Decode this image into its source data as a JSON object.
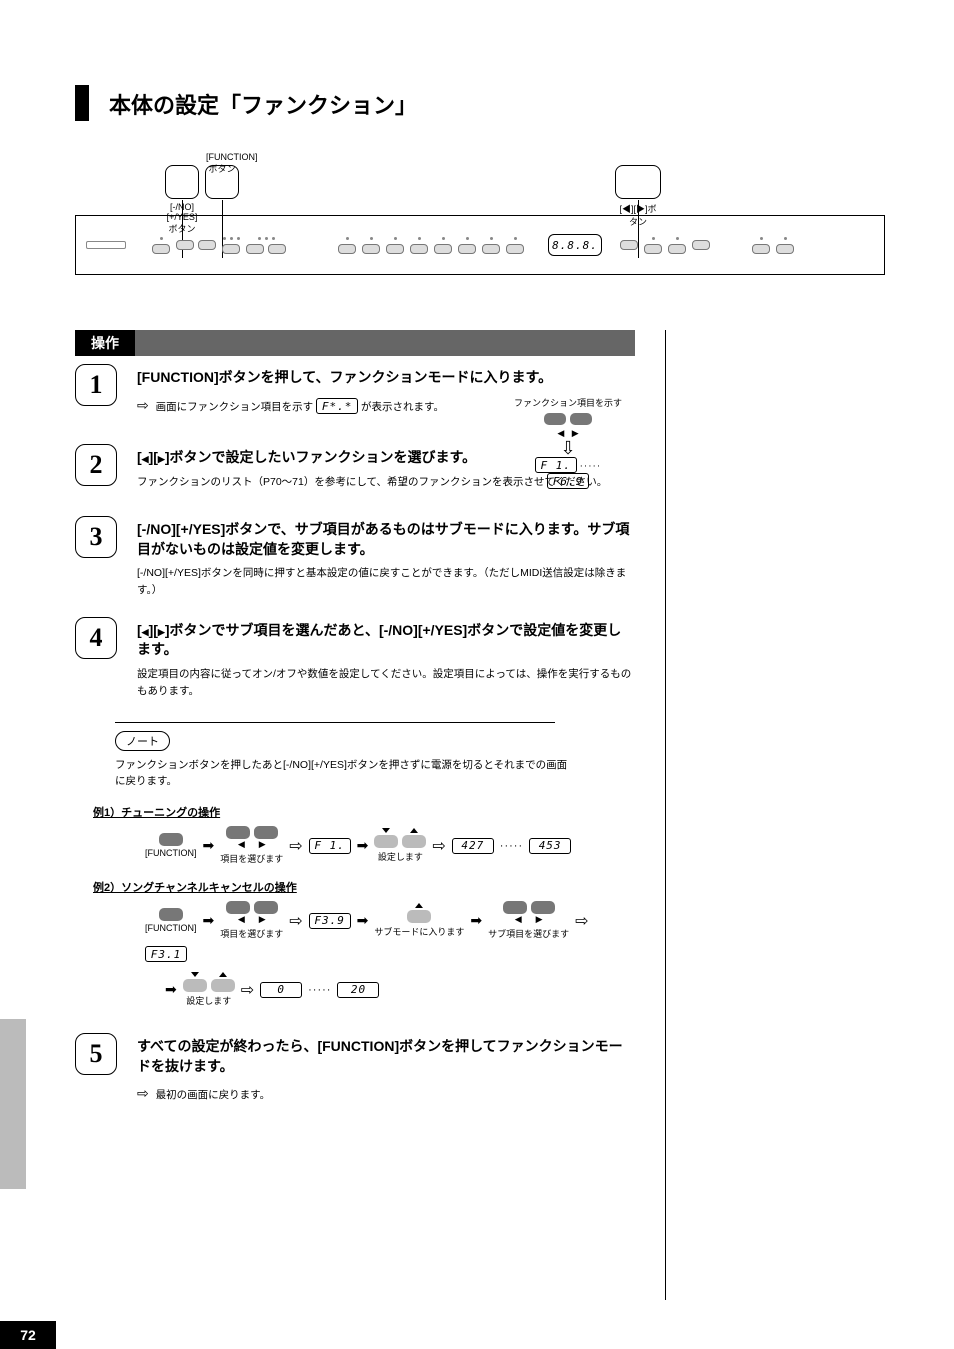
{
  "chapter": {
    "title": "本体の設定「ファンクション」"
  },
  "panel": {
    "callouts": {
      "left_prev": "[-/NO][+/YES]ボタン",
      "left_next": "[FUNCTION]ボタン",
      "right": "[◀][▶]ボタン"
    },
    "lcd": "8.8.8."
  },
  "operation": {
    "ribbon": "操作"
  },
  "steps": [
    {
      "num": "1",
      "title": "[FUNCTION]ボタンを押して、ファンクションモードに入ります。",
      "body_prefix": "",
      "body_arrow": "画面にファンクション項目を示す",
      "body_suffix": "が表示されます。"
    },
    {
      "num": "2",
      "title": "[◀][▶]ボタンで設定したいファンクションを選びます。",
      "body": "ファンクションのリスト（P70〜71）を参考にして、希望のファンクションを表示させてください。"
    },
    {
      "num": "3",
      "title": "[-/NO][+/YES]ボタンで、サブ項目があるものはサブモードに入ります。サブ項目がないものは設定値を変更します。",
      "body": "[-/NO][+/YES]ボタンを同時に押すと基本設定の値に戻すことができます。（ただしMIDI送信設定は除きます。）"
    },
    {
      "num": "4",
      "title": "[◀][▶]ボタンでサブ項目を選んだあと、[-/NO][+/YES]ボタンで設定値を変更します。",
      "body": "設定項目の内容に従ってオン/オフや数値を設定してください。設定項目によっては、操作を実行するものもあります。"
    }
  ],
  "mini_diagram": {
    "line1": "ファンクション項目を示す",
    "disp1": "F*.*",
    "disp_low": "F 1.",
    "disp_high": "F6.9"
  },
  "note": {
    "label": "ノート",
    "text": "ファンクションボタンを押したあと[-/NO][+/YES]ボタンを押さずに電源を切るとそれまでの画面に戻ります。"
  },
  "flows": {
    "tune": {
      "heading": "例1）チューニングの操作",
      "cap_func": "[FUNCTION]",
      "cap_pair": "項目を選びます",
      "disp": "F 1.",
      "cap_set": "設定します",
      "range_low": "427",
      "range_high": "453"
    },
    "cancel": {
      "heading": "例2）ソングチャンネルキャンセルの操作",
      "cap_func": "[FUNCTION]",
      "cap_pair1": "項目を選びます",
      "disp1": "F3.9",
      "cap_enter": "サブモードに入ります",
      "cap_pair2": "サブ項目を選びます",
      "disp2": "F3.1",
      "cap_set": "設定します",
      "range_low": "  0",
      "range_high": " 20"
    }
  },
  "step5": {
    "num": "5",
    "title": "すべての設定が終わったら、[FUNCTION]ボタンを押してファンクションモードを抜けます。",
    "body_arrow": "最初の画面に戻ります。"
  },
  "page_number": "72"
}
